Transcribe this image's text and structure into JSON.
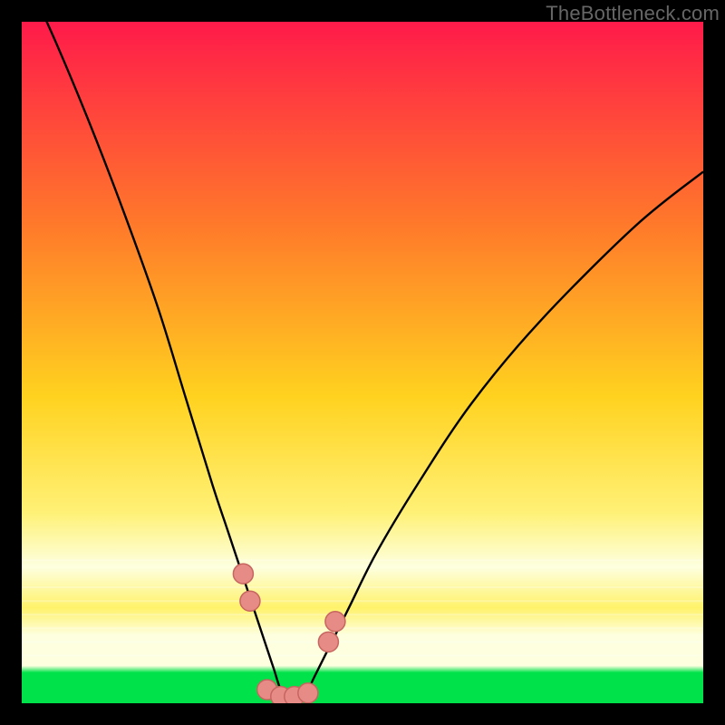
{
  "attribution": "TheBottleneck.com",
  "colors": {
    "frame": "#000000",
    "grad_top": "#ff1a4a",
    "grad_mid1": "#ff7a2a",
    "grad_mid2": "#ffd21f",
    "grad_mid3": "#fff176",
    "grad_band_pale": "#fdffdf",
    "grad_band_yellow": "#fff26a",
    "grad_band_green": "#00e24a",
    "curve": "#000000",
    "marker_fill": "#e78b86",
    "marker_stroke": "#c76560"
  },
  "chart_data": {
    "type": "line",
    "title": "",
    "xlabel": "",
    "ylabel": "",
    "xlim": [
      0,
      100
    ],
    "ylim": [
      0,
      100
    ],
    "series": [
      {
        "name": "bottleneck-curve",
        "x": [
          0,
          5,
          10,
          15,
          20,
          24,
          28,
          30,
          32,
          34,
          36,
          37,
          38,
          39,
          40,
          41,
          42,
          43,
          45,
          48,
          52,
          58,
          66,
          76,
          90,
          100
        ],
        "y": [
          108,
          97,
          85,
          72,
          58,
          45,
          32,
          26,
          20,
          14,
          8,
          5,
          2,
          1,
          1,
          1,
          2,
          4,
          8,
          14,
          22,
          32,
          44,
          56,
          70,
          78
        ]
      }
    ],
    "markers": [
      {
        "name": "left-1",
        "x": 32.5,
        "y": 19
      },
      {
        "name": "left-2",
        "x": 33.5,
        "y": 15
      },
      {
        "name": "right-1",
        "x": 45,
        "y": 9
      },
      {
        "name": "right-2",
        "x": 46,
        "y": 12
      },
      {
        "name": "floor-1",
        "x": 36,
        "y": 2
      },
      {
        "name": "floor-2",
        "x": 38,
        "y": 1
      },
      {
        "name": "floor-3",
        "x": 40,
        "y": 1
      },
      {
        "name": "floor-4",
        "x": 42,
        "y": 1.5
      }
    ],
    "gradient_bands_y": [
      79,
      83,
      85,
      87,
      89,
      91,
      93
    ]
  }
}
